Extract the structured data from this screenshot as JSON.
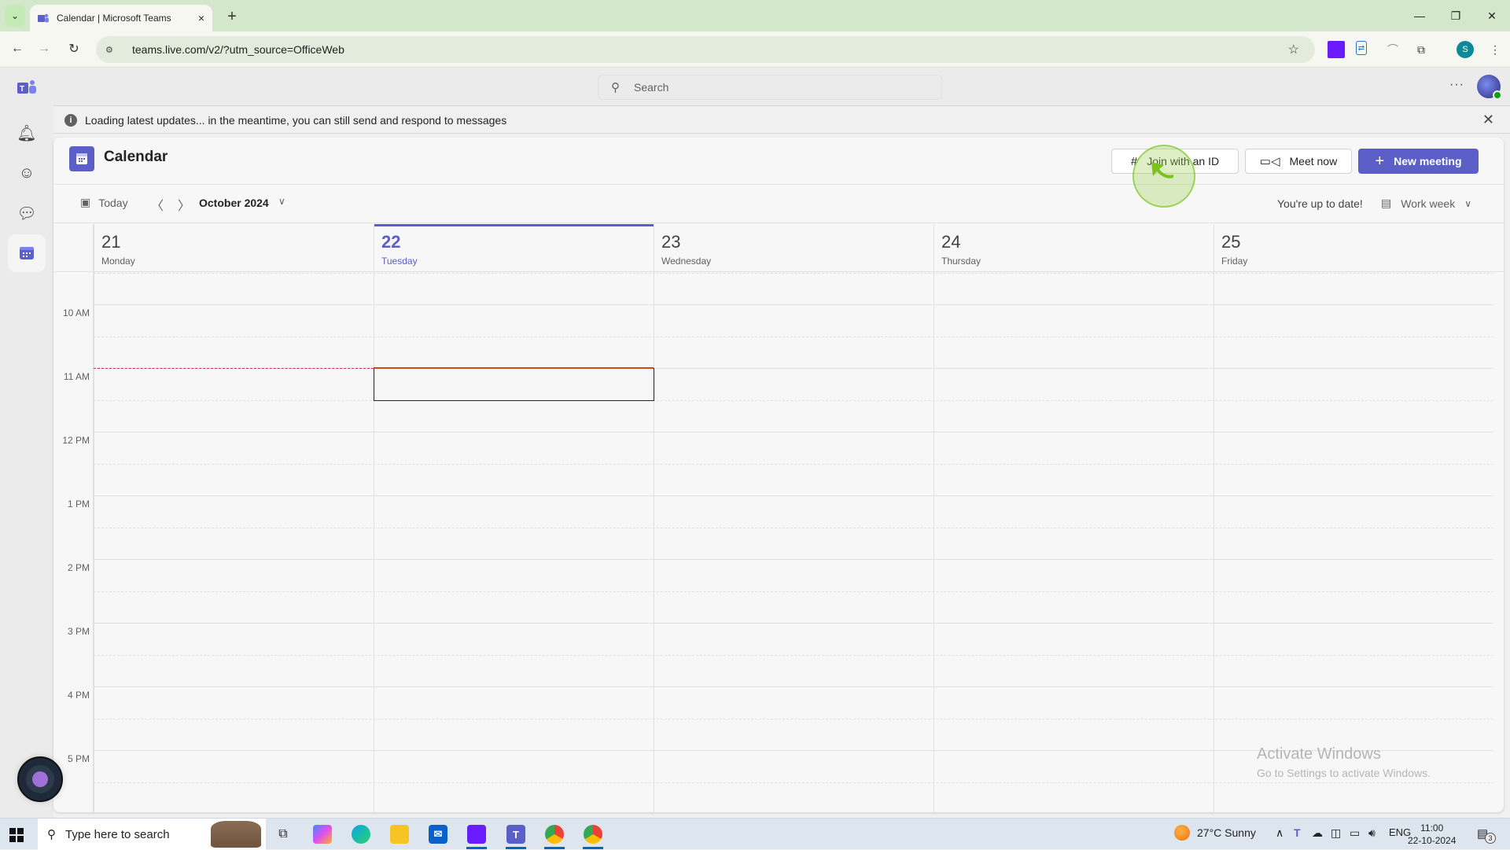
{
  "browser": {
    "tab_title": "Calendar | Microsoft Teams",
    "tab_close_icon": "×",
    "new_tab_icon": "+",
    "url": "teams.live.com/v2/?utm_source=OfficeWeb",
    "profile_initial": "S",
    "window_controls": {
      "minimize": "—",
      "restore": "❐",
      "close": "✕"
    }
  },
  "teams": {
    "search_placeholder": "Search",
    "more_label": "···",
    "banner_text": "Loading latest updates... in the meantime, you can still send and respond to messages",
    "banner_info": "i",
    "rail": [
      {
        "name": "activity",
        "icon": "bell-icon"
      },
      {
        "name": "communities",
        "icon": "people-icon"
      },
      {
        "name": "chat",
        "icon": "chat-icon"
      },
      {
        "name": "calendar",
        "icon": "calendar-icon",
        "active": true
      }
    ],
    "calendar": {
      "title": "Calendar",
      "buttons": {
        "join_id": "Join with an ID",
        "meet_now": "Meet now",
        "new_meeting": "New meeting"
      },
      "today_label": "Today",
      "month_label": "October 2024",
      "status": "You're up to date!",
      "view_label": "Work week",
      "days": [
        {
          "num": "21",
          "name": "Monday",
          "today": false
        },
        {
          "num": "22",
          "name": "Tuesday",
          "today": true
        },
        {
          "num": "23",
          "name": "Wednesday",
          "today": false
        },
        {
          "num": "24",
          "name": "Thursday",
          "today": false
        },
        {
          "num": "25",
          "name": "Friday",
          "today": false
        }
      ],
      "hours": [
        "10 AM",
        "11 AM",
        "12 PM",
        "1 PM",
        "2 PM",
        "3 PM",
        "4 PM",
        "5 PM"
      ],
      "current_time": "11:00",
      "accent": "#5b5fc7",
      "now_color": "#cc4a1c"
    }
  },
  "watermark": {
    "line1": "Activate Windows",
    "line2": "Go to Settings to activate Windows."
  },
  "taskbar": {
    "search_placeholder": "Type here to search",
    "weather": "27°C  Sunny",
    "language": "ENG",
    "time": "11:00",
    "date": "22-10-2024",
    "notification_count": "3"
  }
}
